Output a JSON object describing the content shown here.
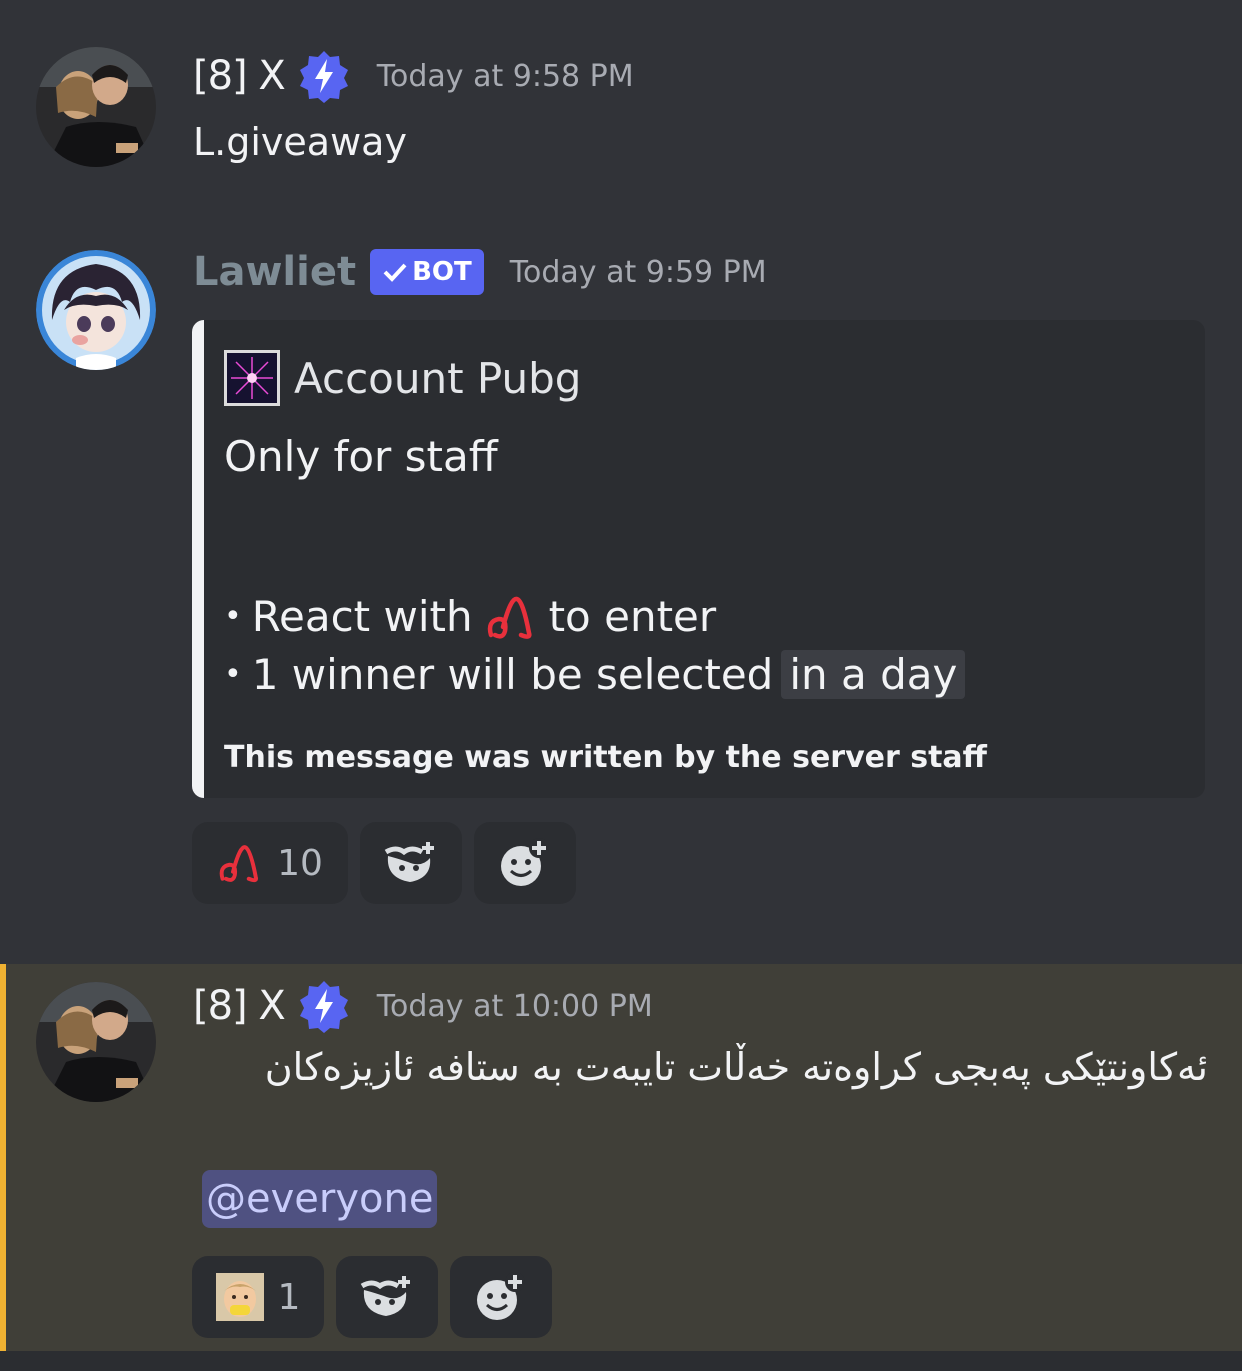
{
  "messages": [
    {
      "username": "[8] X",
      "timestamp": "Today at 9:58 PM",
      "content": "L.giveaway"
    },
    {
      "username": "Lawliet",
      "bot_tag": "BOT",
      "timestamp": "Today at 9:59 PM",
      "embed": {
        "title": "Account Pubg",
        "description": "Only for staff",
        "bullets": [
          {
            "before": "React with",
            "after": "to enter"
          },
          {
            "text": "1 winner will be selected",
            "highlight": "in a day"
          }
        ],
        "footer": "This message was written by the server staff",
        "accent_color": "#f2f3f5"
      },
      "reactions": [
        {
          "icon": "custom-emoji-icon",
          "count": "10"
        },
        {
          "icon": "add-super-reaction-icon"
        },
        {
          "icon": "add-reaction-icon"
        }
      ]
    },
    {
      "username": "[8] X",
      "timestamp": "Today at 10:00 PM",
      "content": "ئەکاونتێکی پەبجی کراوەتە خەڵات تایبەت بە ستافە ئازیزەکان",
      "mention": "@everyone",
      "highlight_color": "#f0b232",
      "reactions": [
        {
          "icon": "baby-emoji-icon",
          "count": "1"
        },
        {
          "icon": "add-super-reaction-icon"
        },
        {
          "icon": "add-reaction-icon"
        }
      ]
    }
  ],
  "colors": {
    "background": "#313338",
    "blurple": "#5865f2",
    "mention_bg": "#4f5181"
  }
}
